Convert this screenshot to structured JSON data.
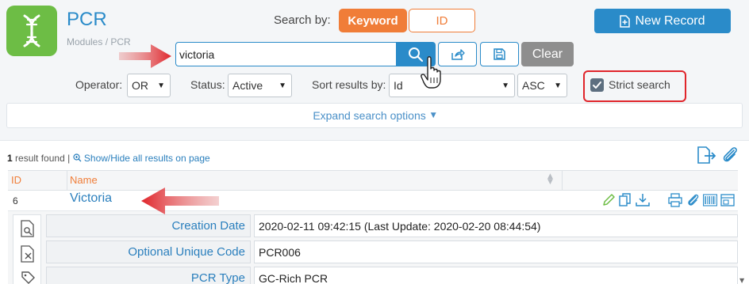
{
  "app": {
    "title": "PCR",
    "breadcrumb": "Modules / PCR",
    "logo_icon": "dna-icon",
    "brand_color": "#2a8bc9",
    "logo_color": "#6dbd45"
  },
  "search": {
    "search_by_label": "Search by:",
    "keyword_label": "Keyword",
    "id_label": "ID",
    "input_value": "victoria",
    "clear_label": "Clear",
    "accent_color": "#f07d38"
  },
  "toolbar": {
    "new_record_label": "New Record"
  },
  "filters": {
    "operator_label": "Operator:",
    "operator_value": "OR",
    "status_label": "Status:",
    "status_value": "Active",
    "sort_label": "Sort results by:",
    "sort_value": "Id",
    "order_value": "ASC",
    "strict_label": "Strict search",
    "strict_checked": true
  },
  "expand": {
    "label": "Expand search options"
  },
  "results": {
    "count": "1",
    "found_label": "result found",
    "separator": "|",
    "show_hide_label": "Show/Hide all results on page"
  },
  "table": {
    "columns": [
      "ID",
      "Name"
    ],
    "rows": [
      {
        "id": "6",
        "name": "Victoria"
      }
    ]
  },
  "details": {
    "fields": [
      {
        "label": "Creation Date",
        "value": "2020-02-11 09:42:15 (Last Update: 2020-02-20 08:44:54)"
      },
      {
        "label": "Optional Unique Code",
        "value": "PCR006"
      },
      {
        "label": "PCR Type",
        "value": "GC-Rich PCR"
      }
    ]
  }
}
